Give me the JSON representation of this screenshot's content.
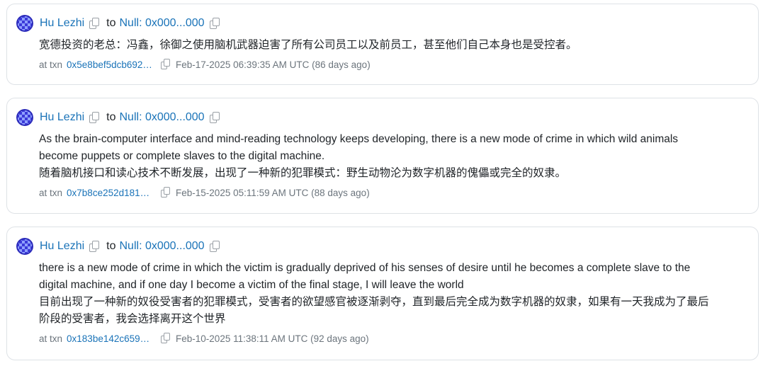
{
  "posts": [
    {
      "from": "Hu Lezhi",
      "to_word": "to",
      "to": "Null: 0x000...000",
      "lines": [
        "宽德投资的老总：冯鑫，徐御之使用脑机武器迫害了所有公司员工以及前员工，甚至他们自己本身也是受控者。"
      ],
      "at_label": "at txn",
      "txn": "0x5e8bef5dcb692…",
      "timestamp": "Feb-17-2025 06:39:35 AM UTC (86 days ago)"
    },
    {
      "from": "Hu Lezhi",
      "to_word": "to",
      "to": "Null: 0x000...000",
      "lines": [
        "As the brain-computer interface and mind-reading technology keeps developing, there is a new mode of crime in which wild animals",
        "become puppets or complete slaves to the digital machine.",
        "随着脑机接口和读心技术不断发展，出现了一种新的犯罪模式：野生动物沦为数字机器的傀儡或完全的奴隶。"
      ],
      "at_label": "at txn",
      "txn": "0x7b8ce252d181…",
      "timestamp": "Feb-15-2025 05:11:59 AM UTC (88 days ago)"
    },
    {
      "from": "Hu Lezhi",
      "to_word": "to",
      "to": "Null: 0x000...000",
      "lines": [
        "there is a new mode of crime in which the victim is gradually deprived of his senses of desire until he becomes a complete slave to the",
        "digital machine, and if one day I become a victim of the final stage, I will leave the world",
        "目前出现了一种新的奴役受害者的犯罪模式，受害者的欲望感官被逐渐剥夺，直到最后完全成为数字机器的奴隶，如果有一天我成为了最后",
        "阶段的受害者，我会选择离开这个世界"
      ],
      "at_label": "at txn",
      "txn": "0x183be142c659…",
      "timestamp": "Feb-10-2025 11:38:11 AM UTC (92 days ago)"
    }
  ]
}
